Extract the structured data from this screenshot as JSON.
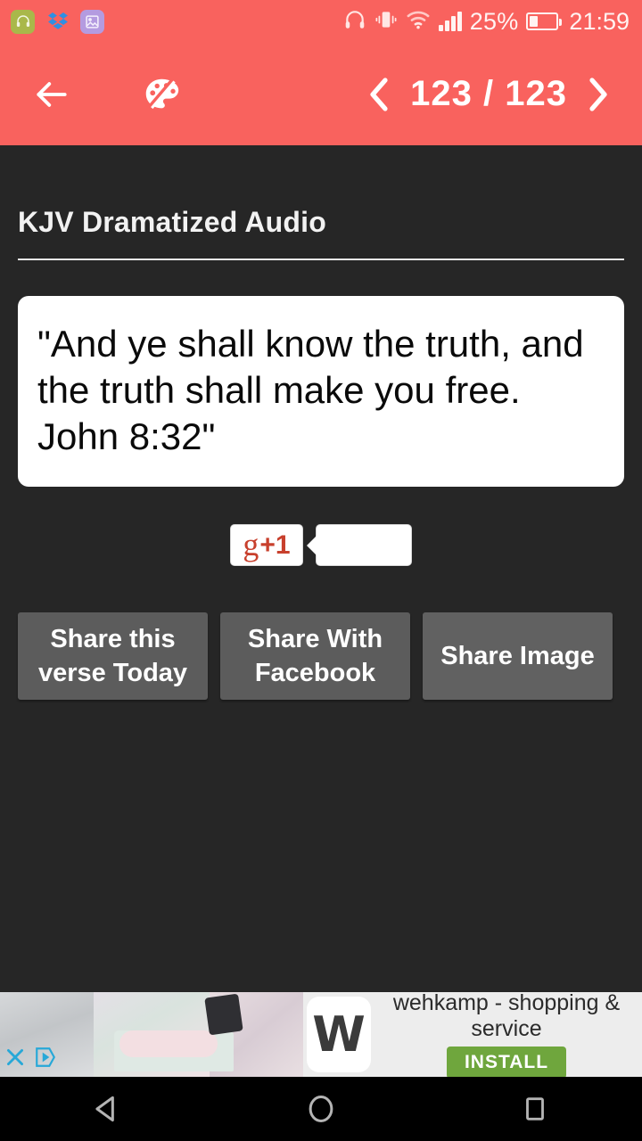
{
  "status_bar": {
    "notifications": [
      {
        "icon": "headphones-icon",
        "bg": "#A9B84A"
      },
      {
        "icon": "dropbox-icon",
        "bg": "#1E7FD4"
      },
      {
        "icon": "gallery-image-icon",
        "bg": "#B49BE0"
      }
    ],
    "system_icons": [
      "headphones-icon",
      "vibrate-icon",
      "wifi-icon",
      "signal-bars-icon",
      "battery-icon"
    ],
    "battery_percent": "25%",
    "time": "21:59",
    "background_color": "#F9625E"
  },
  "app_bar": {
    "back_icon": "back-arrow-icon",
    "theme_icon": "palette-icon",
    "prev_icon": "chevron-left-icon",
    "next_icon": "chevron-right-icon",
    "pager_label": "123 / 123",
    "current_page": "123",
    "total_pages": "123",
    "background_color": "#F9625E"
  },
  "main": {
    "title": "KJV Dramatized Audio",
    "verse": "\"And ye shall know the truth, and the truth shall make you free. John 8:32\"",
    "gplus": {
      "g_letter": "g",
      "plus_one": "+1",
      "count": ""
    },
    "share_buttons": [
      {
        "label": "Share this verse Today",
        "name": "share-verse-today-button"
      },
      {
        "label": "Share With Facebook",
        "name": "share-facebook-button"
      },
      {
        "label": "Share Image",
        "name": "share-image-button"
      }
    ]
  },
  "ad": {
    "logo_letter": "W",
    "title": "wehkamp - shopping & service",
    "install_label": "INSTALL",
    "close_icon": "close-x-icon",
    "adchoices_icon": "adchoices-icon",
    "install_color": "#6FA63D"
  },
  "nav_bar": {
    "back_icon": "nav-back-triangle-icon",
    "home_icon": "nav-home-circle-icon",
    "recents_icon": "nav-recents-square-icon"
  }
}
